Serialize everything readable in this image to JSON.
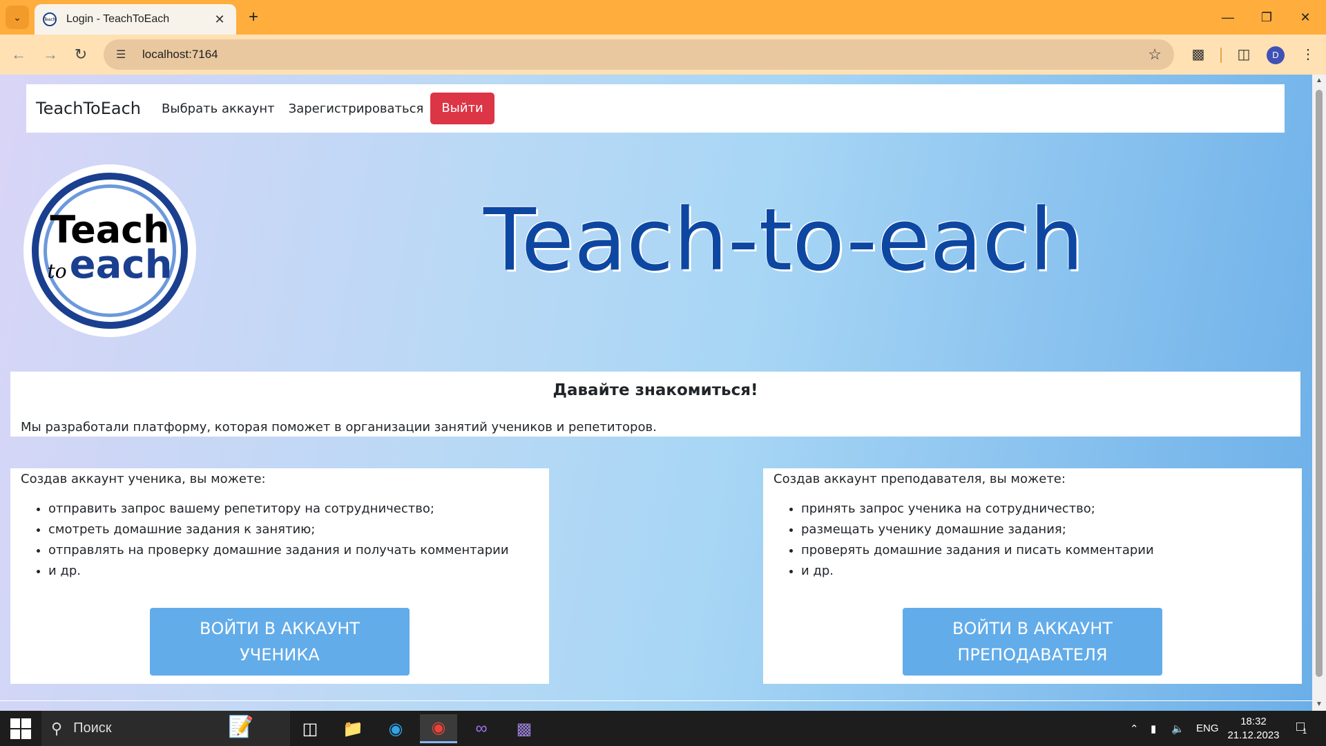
{
  "browser": {
    "tab_title": "Login - TeachToEach",
    "tab_favicon_text": "Teach",
    "url": "localhost:7164",
    "profile_initial": "D"
  },
  "navbar": {
    "brand": "TeachToEach",
    "links": [
      "Выбрать аккаунт",
      "Зарегистрироваться"
    ],
    "logout_label": "Выйти",
    "logout_color": "#dc3545"
  },
  "logo": {
    "top_word": "Teach",
    "small_word": "to",
    "bottom_word": "each"
  },
  "hero": {
    "title": "Teach-to-each",
    "title_color": "#0d47a1"
  },
  "intro": {
    "heading": "Давайте знакомиться!",
    "text": "Мы разработали платформу, которая поможет в организации занятий учеников и репетиторов."
  },
  "student_card": {
    "intro": "Создав аккаунт ученика, вы можете:",
    "items": [
      "отправить запрос вашему репетитору на сотрудничество;",
      "смотреть домашние задания к занятию;",
      "отправлять на проверку домашние задания и получать комментарии",
      "и др."
    ],
    "button_line1": "ВОЙТИ В АККАУНТ",
    "button_line2": "УЧЕНИКА"
  },
  "teacher_card": {
    "intro": "Создав аккаунт преподавателя, вы можете:",
    "items": [
      "принять запрос ученика на сотрудничество;",
      "размещать ученику домашние задания;",
      "проверять домашние задания и писать комментарии",
      "и др."
    ],
    "button_line1": "ВОЙТИ В АККАУНТ",
    "button_line2": "ПРЕПОДАВАТЕЛЯ"
  },
  "taskbar": {
    "search_label": "Поиск",
    "language": "ENG",
    "time": "18:32",
    "date": "21.12.2023",
    "notification_count": "1"
  }
}
